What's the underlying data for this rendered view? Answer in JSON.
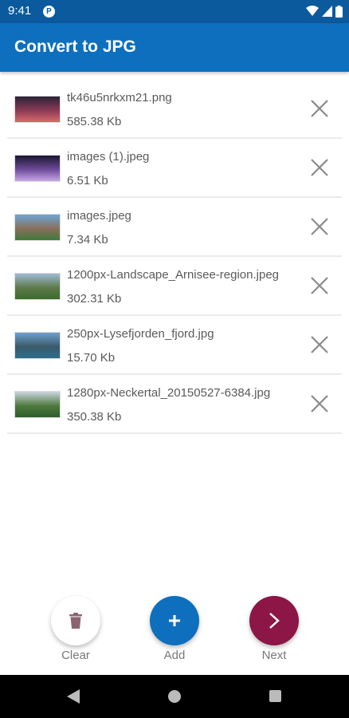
{
  "status_bar": {
    "time": "9:41"
  },
  "app_bar": {
    "title": "Convert to JPG"
  },
  "files": [
    {
      "name": "tk46u5nrkxm21.png",
      "size": "585.38 Kb",
      "colors": [
        "#2a2338",
        "#8c3a56",
        "#d86a6a"
      ]
    },
    {
      "name": "images (1).jpeg",
      "size": "6.51 Kb",
      "colors": [
        "#1a1730",
        "#6e4c9a",
        "#c8a6e6"
      ]
    },
    {
      "name": "images.jpeg",
      "size": "7.34 Kb",
      "colors": [
        "#6aa6d8",
        "#8a6f5a",
        "#3e7a3a"
      ]
    },
    {
      "name": "1200px-Landscape_Arnisee-region.jpeg",
      "size": "302.31 Kb",
      "colors": [
        "#9dbbd6",
        "#5e7a4a",
        "#3b6b2c"
      ]
    },
    {
      "name": "250px-Lysefjorden_fjord.jpg",
      "size": "15.70 Kb",
      "colors": [
        "#6f9fcf",
        "#3a5a6a",
        "#2d6e8e"
      ]
    },
    {
      "name": "1280px-Neckertal_20150527-6384.jpg",
      "size": "350.38 Kb",
      "colors": [
        "#c9d6df",
        "#4e7a3e",
        "#2f5e2a"
      ]
    }
  ],
  "actions": {
    "clear_label": "Clear",
    "add_label": "Add",
    "next_label": "Next",
    "add_color": "#0d6fbe",
    "next_color": "#8c1646",
    "clear_icon_color": "#8a6570"
  },
  "icons": {
    "remove": "close-icon",
    "clear": "trash-icon",
    "add": "plus-icon",
    "next": "chevron-right-icon"
  }
}
